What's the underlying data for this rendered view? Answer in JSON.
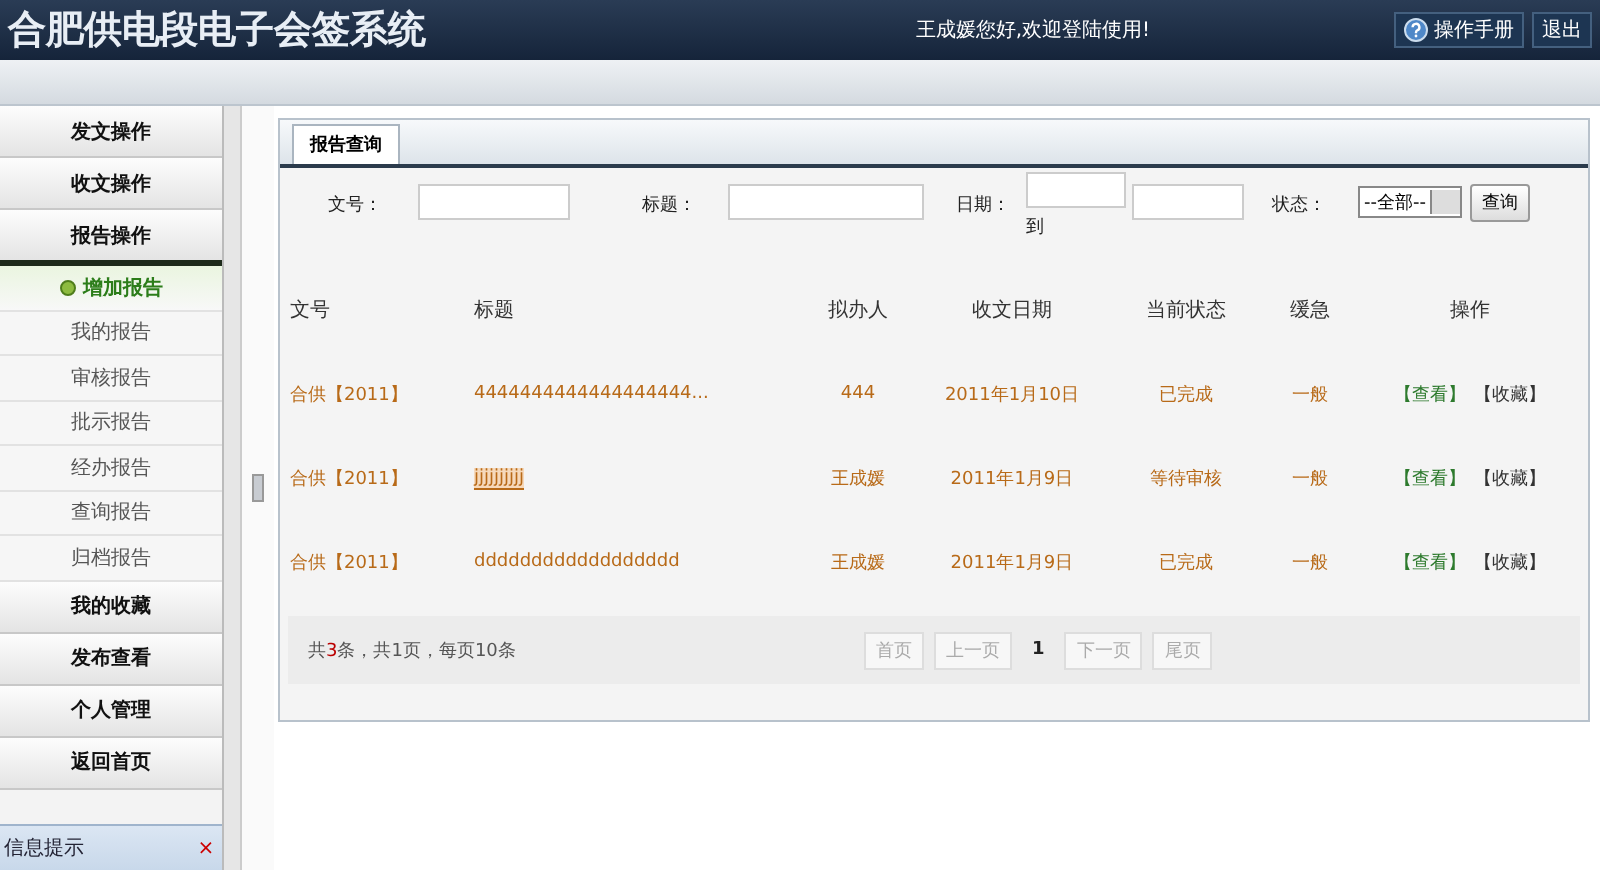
{
  "header": {
    "title": "合肥供电段电子会签系统",
    "welcome": "王成媛您好,欢迎登陆使用!",
    "buttons": [
      {
        "kind": "help",
        "label": "操作手册"
      },
      {
        "kind": "plain",
        "label": "退出"
      }
    ]
  },
  "sidebar": {
    "items": [
      {
        "label": "发文操作",
        "expanded": false
      },
      {
        "label": "收文操作",
        "expanded": false
      },
      {
        "label": "报告操作",
        "expanded": true,
        "children": [
          {
            "label": "增加报告",
            "selected": true
          },
          {
            "label": "我的报告",
            "selected": false
          },
          {
            "label": "审核报告",
            "selected": false
          },
          {
            "label": "批示报告",
            "selected": false
          },
          {
            "label": "经办报告",
            "selected": false
          },
          {
            "label": "查询报告",
            "selected": false
          },
          {
            "label": "归档报告",
            "selected": false
          }
        ]
      },
      {
        "label": "我的收藏",
        "expanded": false
      },
      {
        "label": "发布查看",
        "expanded": false
      },
      {
        "label": "个人管理",
        "expanded": false
      },
      {
        "label": "返回首页",
        "expanded": false
      }
    ],
    "info": {
      "title": "信息提示",
      "close": "×"
    }
  },
  "tab": {
    "label": "报告查询",
    "selected": true
  },
  "filters": {
    "doc_no": "文号：",
    "title": "标题：",
    "date": "日期：",
    "to": "到",
    "status": "状态：",
    "status_value": "--全部--",
    "search": "查询"
  },
  "table": {
    "columns": [
      "文号",
      "标题",
      "拟办人",
      "收文日期",
      "当前状态",
      "缓急",
      "操作"
    ],
    "rows": [
      {
        "doc_no": "合供【2011】",
        "title": "4444444444444444444...",
        "underlined": false,
        "handler": "444",
        "date": "2011年1月10日",
        "status": "已完成",
        "urgency": "一般",
        "actions": [
          "【查看】",
          "【收藏】"
        ]
      },
      {
        "doc_no": "合供【2011】",
        "title": "jjjjjjjjjj",
        "underlined": true,
        "handler": "王成媛",
        "date": "2011年1月9日",
        "status": "等待审核",
        "urgency": "一般",
        "actions": [
          "【查看】",
          "【收藏】"
        ]
      },
      {
        "doc_no": "合供【2011】",
        "title": "dddddddddddddddddd",
        "underlined": false,
        "handler": "王成媛",
        "date": "2011年1月9日",
        "status": "已完成",
        "urgency": "一般",
        "actions": [
          "【查看】",
          "【收藏】"
        ]
      }
    ]
  },
  "summary": {
    "before": "共",
    "count": "3",
    "after": "条，共1页，每页10条"
  },
  "pager": [
    {
      "label": "首页",
      "disabled": true
    },
    {
      "label": "上一页",
      "disabled": true
    },
    {
      "label": "1",
      "disabled": false,
      "kind": "current"
    },
    {
      "label": "下一页",
      "disabled": true
    },
    {
      "label": "尾页",
      "disabled": true
    }
  ]
}
